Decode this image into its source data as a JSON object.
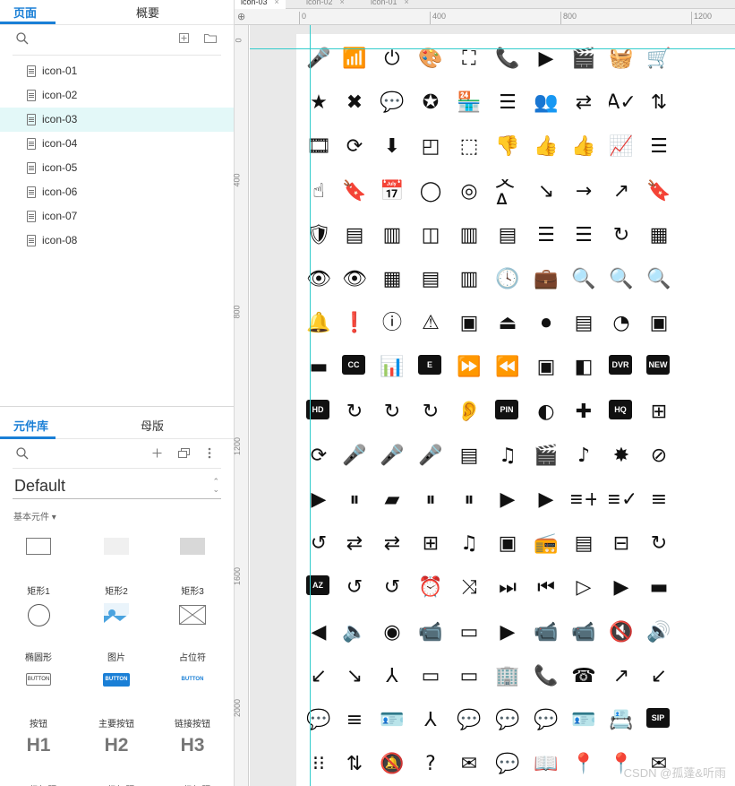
{
  "left_panel": {
    "tabs": [
      "页面",
      "概要"
    ],
    "pages": [
      "icon-01",
      "icon-02",
      "icon-03",
      "icon-04",
      "icon-05",
      "icon-06",
      "icon-07",
      "icon-08"
    ],
    "selected_page": "icon-03",
    "library_tabs": [
      "元件库",
      "母版"
    ],
    "library_dropdown": "Default",
    "category": "基本元件 ▾",
    "widgets": [
      {
        "label": "矩形1",
        "kind": "rect1"
      },
      {
        "label": "矩形2",
        "kind": "rect2"
      },
      {
        "label": "矩形3",
        "kind": "rect3"
      },
      {
        "label": "椭圆形",
        "kind": "ellipse"
      },
      {
        "label": "图片",
        "kind": "image"
      },
      {
        "label": "占位符",
        "kind": "placeholder"
      },
      {
        "label": "按钮",
        "kind": "button",
        "text": "BUTTON"
      },
      {
        "label": "主要按钮",
        "kind": "primary",
        "text": "BUTTON"
      },
      {
        "label": "链接按钮",
        "kind": "link",
        "text": "BUTTON"
      },
      {
        "label": "一级标题",
        "kind": "h",
        "text": "H1"
      },
      {
        "label": "二级标题",
        "kind": "h",
        "text": "H2"
      },
      {
        "label": "三级标题",
        "kind": "h",
        "text": "H3"
      }
    ],
    "accent": "#1a7fd6"
  },
  "editor": {
    "tabs": [
      {
        "label": "icon-03",
        "active": true
      },
      {
        "label": "icon-02",
        "active": false
      },
      {
        "label": "icon-01",
        "active": false
      }
    ],
    "ruler_h": [
      "0",
      "400",
      "800",
      "1200"
    ],
    "ruler_v": [
      "400",
      "800",
      "1200",
      "1600",
      "2000"
    ],
    "guide_color": "#33cccc",
    "icon_rows": [
      [
        "🎤",
        "📶",
        "⏻",
        "🎨",
        "⛶",
        "📞",
        "▶",
        "🎬",
        "🧺",
        "🛒"
      ],
      [
        "★",
        "✖",
        "💬",
        "✪",
        "🏪",
        "☰",
        "👥",
        "⇄",
        "A✓",
        "⇅"
      ],
      [
        "🎞",
        "⟳",
        "⬇",
        "◰",
        "⬚",
        "👎",
        "👍",
        "👍",
        "📈",
        "☰"
      ],
      [
        "☝",
        "🔖",
        "📅",
        "◯",
        "◎",
        "文A",
        "↘",
        "→",
        "↗",
        "🔖"
      ],
      [
        "🛡",
        "▤",
        "▥",
        "◫",
        "▥",
        "▤",
        "☰",
        "☰",
        "↻",
        "▦"
      ],
      [
        "👁",
        "👁",
        "▦",
        "▤",
        "▥",
        "🕓",
        "💼",
        "🔍",
        "🔍",
        "🔍"
      ],
      [
        "🔔",
        "❗",
        "ⓘ",
        "⚠",
        "▣",
        "⏏",
        "⏺",
        "▤",
        "◔",
        "▣"
      ],
      [
        "▬",
        "CC",
        "📊",
        "E",
        "⏩",
        "⏪",
        "▣",
        "◧",
        "DVR",
        "NEW"
      ],
      [
        "HD",
        "↻",
        "↻",
        "↻",
        "👂",
        "PIN",
        "◐",
        "✚",
        "HQ",
        "⊞"
      ],
      [
        "⟳",
        "🎤",
        "🎤",
        "🎤",
        "▤",
        "♫",
        "🎬",
        "♪",
        "✸",
        "⊘"
      ],
      [
        "▶",
        "⏸",
        "▰",
        "⏸",
        "⏸",
        "▶",
        "▶",
        "≡+",
        "≡✓",
        "≡"
      ],
      [
        "↺",
        "⇄",
        "⇄",
        "⊞",
        "♫",
        "▣",
        "📻",
        "▤",
        "⊟",
        "↻"
      ],
      [
        "AZ",
        "↺",
        "↺",
        "⏰",
        "⤨",
        "⏭",
        "⏮",
        "▷",
        "▶",
        "▬"
      ],
      [
        "◀",
        "🔈",
        "◉",
        "📹",
        "▭",
        "▶",
        "📹",
        "📹",
        "🔇",
        "🔊"
      ],
      [
        "↙",
        "↘",
        "⅄",
        "▭",
        "▭",
        "🏢",
        "📞",
        "☎",
        "↗",
        "↙"
      ],
      [
        "💬",
        "≡",
        "🪪",
        "⅄",
        "💬",
        "💬",
        "💬",
        "🪪",
        "📇",
        "SIP"
      ],
      [
        "⁝⁝",
        "⇅",
        "🔕",
        "?",
        "✉",
        "💬",
        "📖",
        "📍",
        "📍",
        "✉"
      ]
    ],
    "watermark": "CSDN @孤蓬&听雨"
  }
}
